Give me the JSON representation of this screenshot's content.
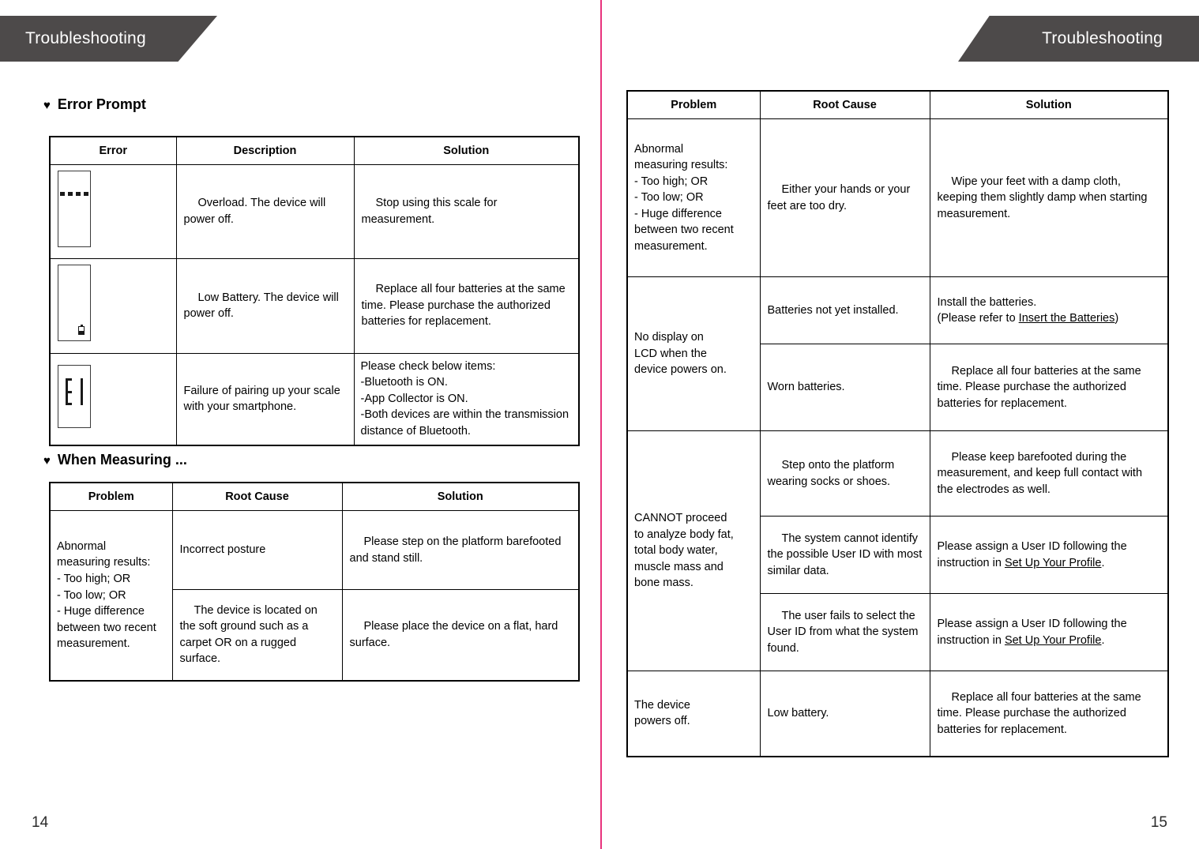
{
  "document": {
    "chapter_tab_label": "Troubleshooting"
  },
  "left_page": {
    "tab_label": "Troubleshooting",
    "page_number": "14",
    "sections": [
      {
        "bullet": "♥",
        "heading": "Error Prompt",
        "table": {
          "headers": [
            "Error",
            "Description",
            "Solution"
          ],
          "rows": [
            {
              "icon": "lcd-overload-icon",
              "description": "Overload. The device will power off.",
              "solution": "Stop using this scale for measurement."
            },
            {
              "icon": "lcd-low-battery-icon",
              "description": "Low Battery. The device will power off.",
              "solution": "Replace all four batteries at the same time. Please purchase the authorized batteries for replacement."
            },
            {
              "icon": "lcd-err1-icon",
              "description": "Failure of pairing up your scale with your smartphone.",
              "solution_lines": [
                "Please check below items:",
                "-Bluetooth is ON.",
                "-App Collector is ON.",
                "-Both devices are within the transmission distance of Bluetooth."
              ]
            }
          ]
        }
      },
      {
        "bullet": "♥",
        "heading": "When Measuring ...",
        "table": {
          "headers": [
            "Problem",
            "Root Cause",
            "Solution"
          ],
          "problem_lines": [
            "Abnormal",
            "measuring results:",
            "- Too high; OR",
            "- Too low; OR",
            "- Huge difference",
            "between two recent",
            "measurement."
          ],
          "rows": [
            {
              "root_cause": "Incorrect posture",
              "solution": "Please step on the platform barefooted and stand still."
            },
            {
              "root_cause": "The device is located on the soft ground such as a carpet OR on a rugged surface.",
              "solution": "Please place the device on a flat, hard surface."
            }
          ]
        }
      }
    ]
  },
  "right_page": {
    "tab_label": "Troubleshooting",
    "page_number": "15",
    "table": {
      "headers": [
        "Problem",
        "Root Cause",
        "Solution"
      ],
      "groups": [
        {
          "problem_lines": [
            "Abnormal",
            "measuring results:",
            "- Too high; OR",
            "- Too low; OR",
            "- Huge difference",
            "between two recent",
            "measurement."
          ],
          "rows": [
            {
              "root_cause": "Either your hands or your feet are too dry.",
              "solution": "Wipe your feet with a damp cloth, keeping them slightly damp when starting measurement."
            }
          ]
        },
        {
          "problem_lines": [
            "No display on",
            "LCD when the",
            "device powers on."
          ],
          "rows": [
            {
              "root_cause": "Batteries not yet installed.",
              "solution_prefix": "Install the batteries.",
              "solution_body_before": "(Please refer to ",
              "solution_link": "Insert the Batteries",
              "solution_body_after": ")"
            },
            {
              "root_cause": "Worn batteries.",
              "solution": "Replace all four batteries at the same time. Please purchase the authorized batteries for replacement."
            }
          ]
        },
        {
          "problem_lines": [
            "CANNOT proceed",
            "to analyze body fat,",
            "total body water,",
            "muscle mass and",
            "bone mass."
          ],
          "rows": [
            {
              "root_cause": "Step onto the platform wearing socks or shoes.",
              "solution": "Please keep barefooted during the measurement, and keep full contact with the electrodes as well."
            },
            {
              "root_cause": "The system cannot identify the possible User ID with most similar data.",
              "solution_body_before": "Please assign a User ID following the instruction in ",
              "solution_link": "Set Up Your Profile",
              "solution_body_after": "."
            },
            {
              "root_cause": "The user fails to select the User ID from what the system found.",
              "solution_body_before": "Please assign a User ID following the instruction in ",
              "solution_link": "Set Up Your Profile",
              "solution_body_after": "."
            }
          ]
        },
        {
          "problem_lines": [
            "The device",
            "powers off."
          ],
          "rows": [
            {
              "root_cause": "Low battery.",
              "solution": "Replace all four batteries at the same time. Please purchase the authorized batteries for replacement."
            }
          ]
        }
      ]
    }
  },
  "colors": {
    "tab_background": "#4d4a4a",
    "tab_text": "#ffffff",
    "gutter_line": "#e8327c",
    "table_border": "#000000",
    "body_text": "#000000"
  }
}
